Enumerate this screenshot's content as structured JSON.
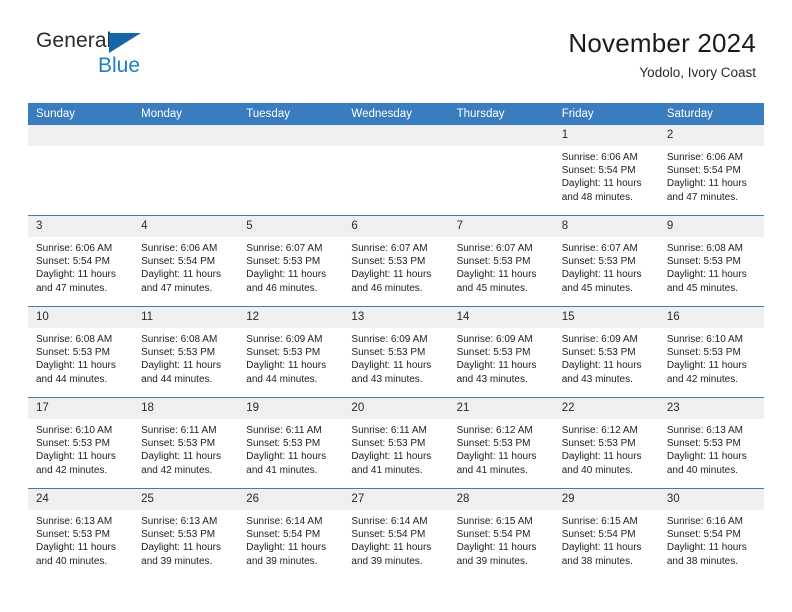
{
  "brand": {
    "name_part1": "General",
    "name_part2": "Blue"
  },
  "header": {
    "title": "November 2024",
    "location": "Yodolo, Ivory Coast"
  },
  "colors": {
    "header_blue": "#3a7dbf",
    "logo_blue": "#1f7ec4",
    "daynum_band": "#efefef"
  },
  "weekdays": [
    "Sunday",
    "Monday",
    "Tuesday",
    "Wednesday",
    "Thursday",
    "Friday",
    "Saturday"
  ],
  "weeks": [
    [
      {
        "day": "",
        "empty": true
      },
      {
        "day": "",
        "empty": true
      },
      {
        "day": "",
        "empty": true
      },
      {
        "day": "",
        "empty": true
      },
      {
        "day": "",
        "empty": true
      },
      {
        "day": "1",
        "sunrise": "Sunrise: 6:06 AM",
        "sunset": "Sunset: 5:54 PM",
        "daylight": "Daylight: 11 hours and 48 minutes."
      },
      {
        "day": "2",
        "sunrise": "Sunrise: 6:06 AM",
        "sunset": "Sunset: 5:54 PM",
        "daylight": "Daylight: 11 hours and 47 minutes."
      }
    ],
    [
      {
        "day": "3",
        "sunrise": "Sunrise: 6:06 AM",
        "sunset": "Sunset: 5:54 PM",
        "daylight": "Daylight: 11 hours and 47 minutes."
      },
      {
        "day": "4",
        "sunrise": "Sunrise: 6:06 AM",
        "sunset": "Sunset: 5:54 PM",
        "daylight": "Daylight: 11 hours and 47 minutes."
      },
      {
        "day": "5",
        "sunrise": "Sunrise: 6:07 AM",
        "sunset": "Sunset: 5:53 PM",
        "daylight": "Daylight: 11 hours and 46 minutes."
      },
      {
        "day": "6",
        "sunrise": "Sunrise: 6:07 AM",
        "sunset": "Sunset: 5:53 PM",
        "daylight": "Daylight: 11 hours and 46 minutes."
      },
      {
        "day": "7",
        "sunrise": "Sunrise: 6:07 AM",
        "sunset": "Sunset: 5:53 PM",
        "daylight": "Daylight: 11 hours and 45 minutes."
      },
      {
        "day": "8",
        "sunrise": "Sunrise: 6:07 AM",
        "sunset": "Sunset: 5:53 PM",
        "daylight": "Daylight: 11 hours and 45 minutes."
      },
      {
        "day": "9",
        "sunrise": "Sunrise: 6:08 AM",
        "sunset": "Sunset: 5:53 PM",
        "daylight": "Daylight: 11 hours and 45 minutes."
      }
    ],
    [
      {
        "day": "10",
        "sunrise": "Sunrise: 6:08 AM",
        "sunset": "Sunset: 5:53 PM",
        "daylight": "Daylight: 11 hours and 44 minutes."
      },
      {
        "day": "11",
        "sunrise": "Sunrise: 6:08 AM",
        "sunset": "Sunset: 5:53 PM",
        "daylight": "Daylight: 11 hours and 44 minutes."
      },
      {
        "day": "12",
        "sunrise": "Sunrise: 6:09 AM",
        "sunset": "Sunset: 5:53 PM",
        "daylight": "Daylight: 11 hours and 44 minutes."
      },
      {
        "day": "13",
        "sunrise": "Sunrise: 6:09 AM",
        "sunset": "Sunset: 5:53 PM",
        "daylight": "Daylight: 11 hours and 43 minutes."
      },
      {
        "day": "14",
        "sunrise": "Sunrise: 6:09 AM",
        "sunset": "Sunset: 5:53 PM",
        "daylight": "Daylight: 11 hours and 43 minutes."
      },
      {
        "day": "15",
        "sunrise": "Sunrise: 6:09 AM",
        "sunset": "Sunset: 5:53 PM",
        "daylight": "Daylight: 11 hours and 43 minutes."
      },
      {
        "day": "16",
        "sunrise": "Sunrise: 6:10 AM",
        "sunset": "Sunset: 5:53 PM",
        "daylight": "Daylight: 11 hours and 42 minutes."
      }
    ],
    [
      {
        "day": "17",
        "sunrise": "Sunrise: 6:10 AM",
        "sunset": "Sunset: 5:53 PM",
        "daylight": "Daylight: 11 hours and 42 minutes."
      },
      {
        "day": "18",
        "sunrise": "Sunrise: 6:11 AM",
        "sunset": "Sunset: 5:53 PM",
        "daylight": "Daylight: 11 hours and 42 minutes."
      },
      {
        "day": "19",
        "sunrise": "Sunrise: 6:11 AM",
        "sunset": "Sunset: 5:53 PM",
        "daylight": "Daylight: 11 hours and 41 minutes."
      },
      {
        "day": "20",
        "sunrise": "Sunrise: 6:11 AM",
        "sunset": "Sunset: 5:53 PM",
        "daylight": "Daylight: 11 hours and 41 minutes."
      },
      {
        "day": "21",
        "sunrise": "Sunrise: 6:12 AM",
        "sunset": "Sunset: 5:53 PM",
        "daylight": "Daylight: 11 hours and 41 minutes."
      },
      {
        "day": "22",
        "sunrise": "Sunrise: 6:12 AM",
        "sunset": "Sunset: 5:53 PM",
        "daylight": "Daylight: 11 hours and 40 minutes."
      },
      {
        "day": "23",
        "sunrise": "Sunrise: 6:13 AM",
        "sunset": "Sunset: 5:53 PM",
        "daylight": "Daylight: 11 hours and 40 minutes."
      }
    ],
    [
      {
        "day": "24",
        "sunrise": "Sunrise: 6:13 AM",
        "sunset": "Sunset: 5:53 PM",
        "daylight": "Daylight: 11 hours and 40 minutes."
      },
      {
        "day": "25",
        "sunrise": "Sunrise: 6:13 AM",
        "sunset": "Sunset: 5:53 PM",
        "daylight": "Daylight: 11 hours and 39 minutes."
      },
      {
        "day": "26",
        "sunrise": "Sunrise: 6:14 AM",
        "sunset": "Sunset: 5:54 PM",
        "daylight": "Daylight: 11 hours and 39 minutes."
      },
      {
        "day": "27",
        "sunrise": "Sunrise: 6:14 AM",
        "sunset": "Sunset: 5:54 PM",
        "daylight": "Daylight: 11 hours and 39 minutes."
      },
      {
        "day": "28",
        "sunrise": "Sunrise: 6:15 AM",
        "sunset": "Sunset: 5:54 PM",
        "daylight": "Daylight: 11 hours and 39 minutes."
      },
      {
        "day": "29",
        "sunrise": "Sunrise: 6:15 AM",
        "sunset": "Sunset: 5:54 PM",
        "daylight": "Daylight: 11 hours and 38 minutes."
      },
      {
        "day": "30",
        "sunrise": "Sunrise: 6:16 AM",
        "sunset": "Sunset: 5:54 PM",
        "daylight": "Daylight: 11 hours and 38 minutes."
      }
    ]
  ]
}
